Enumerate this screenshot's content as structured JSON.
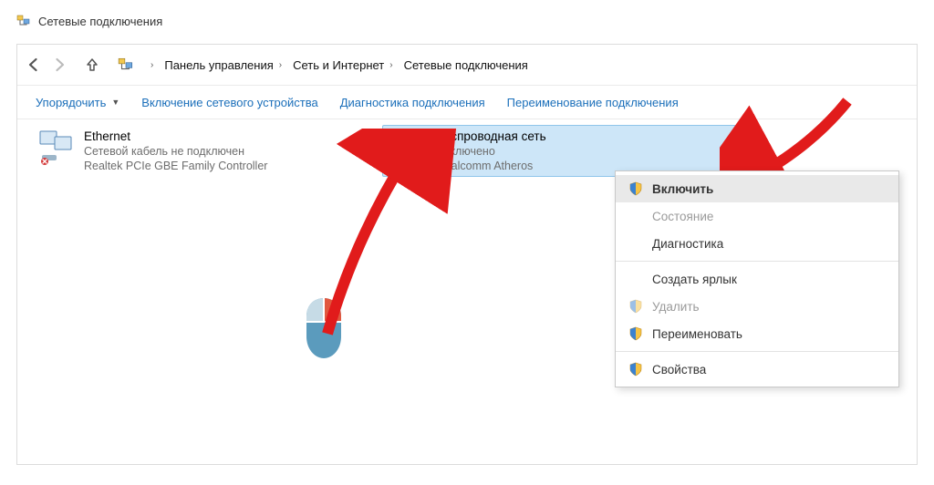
{
  "window_title": "Сетевые подключения",
  "breadcrumbs": {
    "b1": "Панель управления",
    "b2": "Сеть и Интернет",
    "b3": "Сетевые подключения"
  },
  "toolbar": {
    "organize": "Упорядочить",
    "enable_device": "Включение сетевого устройства",
    "diagnose": "Диагностика подключения",
    "rename": "Переименование подключения"
  },
  "adapters": {
    "eth": {
      "name": "Ethernet",
      "status": "Сетевой кабель не подключен",
      "device": "Realtek PCIe GBE Family Controller"
    },
    "wifi": {
      "name": "Беспроводная сеть",
      "status": "Отключено",
      "device": "Qualcomm Atheros"
    }
  },
  "context_menu": {
    "enable": "Включить",
    "state": "Состояние",
    "diag": "Диагностика",
    "shortcut": "Создать ярлык",
    "delete": "Удалить",
    "rename": "Переименовать",
    "props": "Свойства"
  }
}
